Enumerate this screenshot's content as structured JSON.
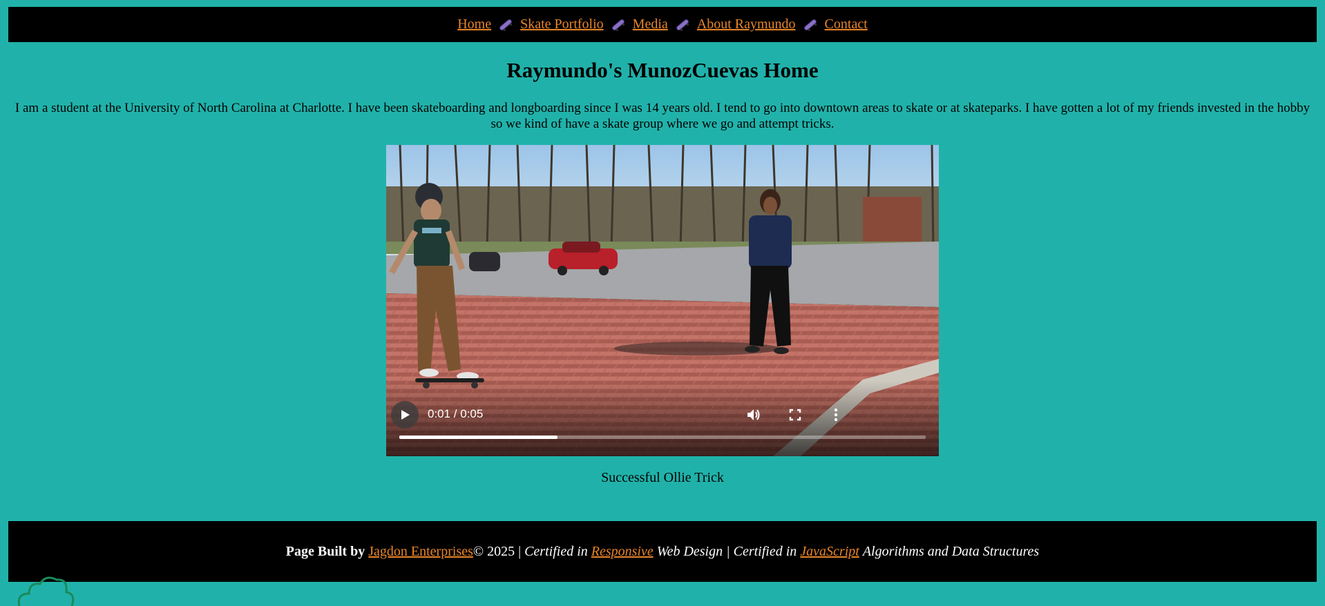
{
  "nav": {
    "items": [
      "Home",
      "Skate Portfolio",
      "Media",
      "About Raymundo",
      "Contact"
    ],
    "separator_icon": "skateboard-icon",
    "link_color": "#e8852a"
  },
  "page": {
    "title": "Raymundo's MunozCuevas Home",
    "intro": "I am a student at the University of North Carolina at Charlotte. I have been skateboarding and longboarding since I was 14 years old. I tend to go into downtown areas to skate or at skateparks. I have gotten a lot of my friends invested in the hobby so we kind of have a skate group where we go and attempt tricks."
  },
  "video": {
    "time": "0:01 / 0:05",
    "progress": 0.3,
    "caption": "Successful Ollie Trick"
  },
  "footer": {
    "built_by": "Page Built by",
    "company": "Jagdon Enterprises",
    "copyright": "© 2025 |",
    "cert1_pre": "Certified in",
    "cert1_link": "Responsive",
    "cert1_post": "Web Design |",
    "cert2_pre": "Certified in",
    "cert2_link": "JavaScript",
    "cert2_post": "Algorithms and Data Structures"
  },
  "colors": {
    "background": "#20b2aa",
    "bar": "#000000",
    "accent": "#e8852a"
  }
}
